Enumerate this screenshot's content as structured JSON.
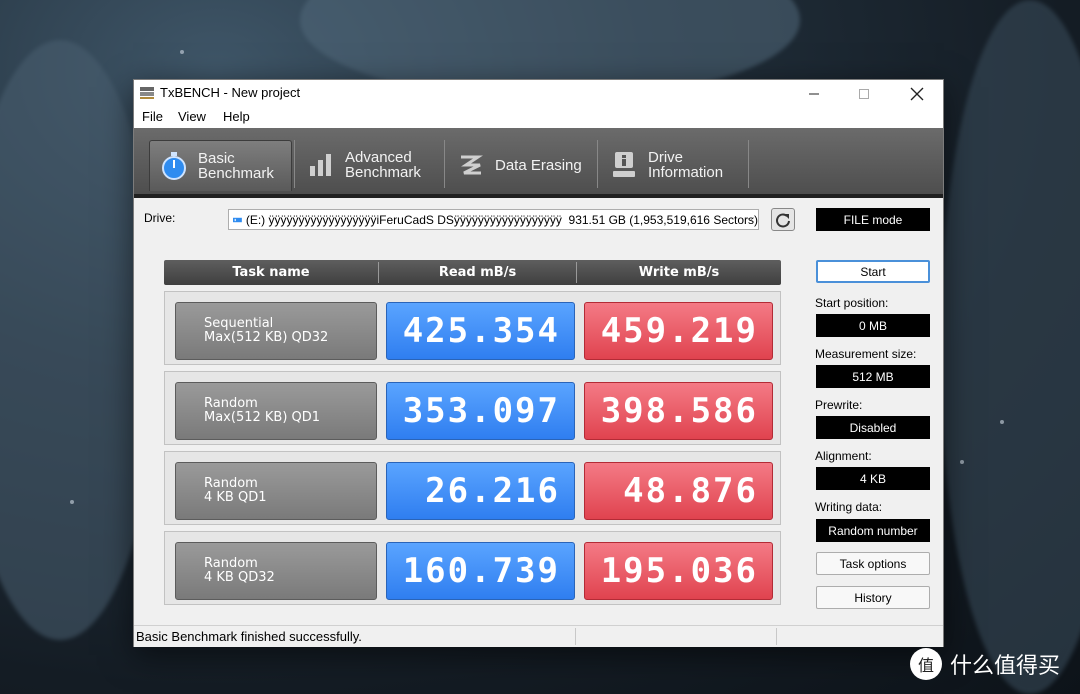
{
  "window": {
    "title": "TxBENCH - New project"
  },
  "menu": [
    "File",
    "View",
    "Help"
  ],
  "tabs": [
    {
      "label": "Basic\nBenchmark",
      "icon": "stopwatch-icon",
      "active": true
    },
    {
      "label": "Advanced\nBenchmark",
      "icon": "bar-chart-icon",
      "active": false
    },
    {
      "label": "Data Erasing",
      "icon": "eraser-icon",
      "active": false
    },
    {
      "label": "Drive\nInformation",
      "icon": "drive-info-icon",
      "active": false
    }
  ],
  "drive": {
    "label": "Drive:",
    "value": "(E:) ÿÿÿÿÿÿÿÿÿÿÿÿÿÿÿÿÿÿiFeruCadS DSÿÿÿÿÿÿÿÿÿÿÿÿÿÿÿÿÿÿ  931.51 GB (1,953,519,616 Sectors)",
    "mode": "FILE mode"
  },
  "grid": {
    "headers": [
      "Task name",
      "Read mB/s",
      "Write mB/s"
    ],
    "rows": [
      {
        "task": "Sequential\nMax(512 KB) QD32",
        "read": "425.354",
        "write": "459.219"
      },
      {
        "task": "Random\nMax(512 KB) QD1",
        "read": "353.097",
        "write": "398.586"
      },
      {
        "task": "Random\n4 KB QD1",
        "read": "26.216",
        "write": "48.876"
      },
      {
        "task": "Random\n4 KB QD32",
        "read": "160.739",
        "write": "195.036"
      }
    ]
  },
  "side": {
    "start": "Start",
    "start_position_label": "Start position:",
    "start_position": "0 MB",
    "measurement_size_label": "Measurement size:",
    "measurement_size": "512 MB",
    "prewrite_label": "Prewrite:",
    "prewrite": "Disabled",
    "alignment_label": "Alignment:",
    "alignment": "4 KB",
    "writing_data_label": "Writing data:",
    "writing_data": "Random number",
    "task_options": "Task options",
    "history": "History"
  },
  "status": {
    "text": "Basic Benchmark finished successfully."
  },
  "watermark": {
    "text": "什么值得买"
  },
  "colors": {
    "read": "#2f7ef0",
    "write": "#e0434f",
    "toolbar": "#5a5a5a"
  }
}
